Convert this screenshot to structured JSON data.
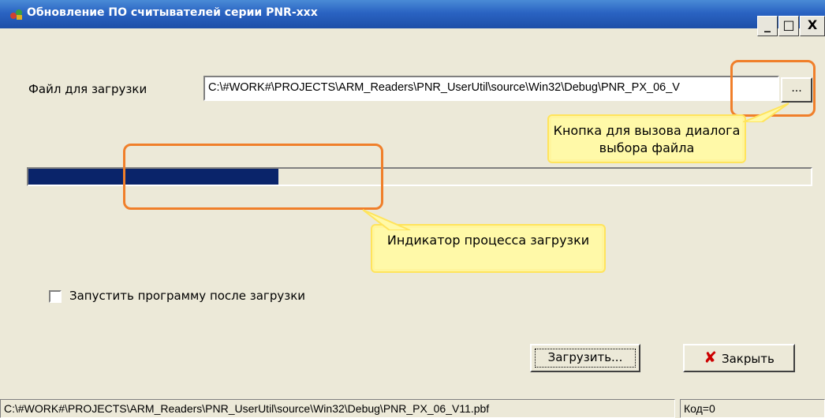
{
  "window": {
    "title": "Обновление ПО считывателей серии PNR-xxx",
    "icon": "app-icon",
    "buttons": {
      "minimize": "_",
      "maximize": "□",
      "close": "X"
    }
  },
  "form": {
    "file_label": "Файл для загрузки",
    "file_value": "C:\\#WORK#\\PROJECTS\\ARM_Readers\\PNR_UserUtil\\source\\Win32\\Debug\\PNR_PX_06_V",
    "browse_label": "...",
    "progress": 0.32,
    "run_after_checkbox_label": "Запустить программу после загрузки",
    "run_after_checked": false,
    "load_button": "Загрузить...",
    "close_button": "Закрыть",
    "close_icon": "red-x-icon"
  },
  "status": {
    "path": "C:\\#WORK#\\PROJECTS\\ARM_Readers\\PNR_UserUtil\\source\\Win32\\Debug\\PNR_PX_06_V11.pbf",
    "code": "Код=0"
  },
  "annotations": {
    "browse_callout": "Кнопка для вызова диалога выбора файла",
    "progress_callout": "Индикатор процесса загрузки",
    "highlight_color": "#f07f2a",
    "callout_color": "#fff9a8"
  }
}
